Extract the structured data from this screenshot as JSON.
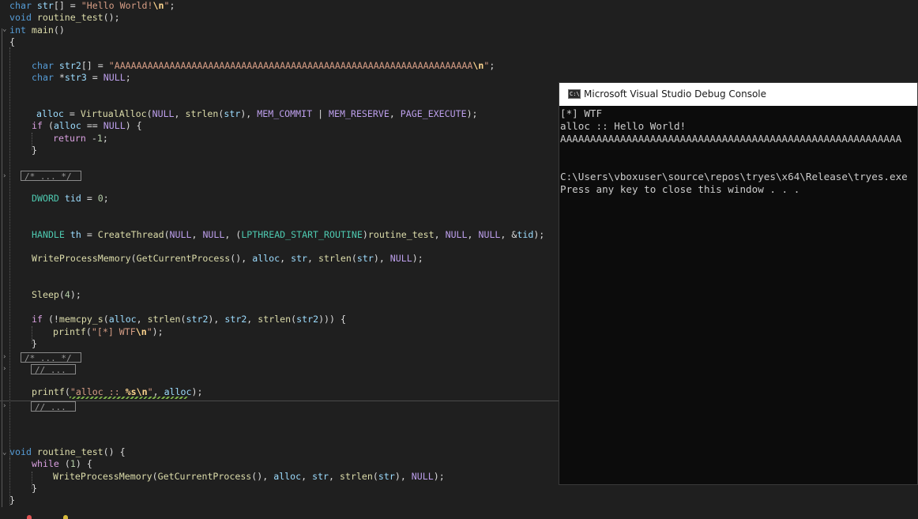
{
  "editor": {
    "lines": [
      [
        {
          "c": "t-kw",
          "t": "char "
        },
        {
          "c": "t-var",
          "t": "str"
        },
        {
          "c": "t-op",
          "t": "[] = "
        },
        {
          "c": "t-str",
          "t": "\"Hello World!"
        },
        {
          "c": "t-esc",
          "t": "\\n"
        },
        {
          "c": "t-str",
          "t": "\""
        },
        {
          "c": "t-op",
          "t": ";"
        }
      ],
      [
        {
          "c": "t-kw",
          "t": "void "
        },
        {
          "c": "t-fn",
          "t": "routine_test"
        },
        {
          "c": "t-op",
          "t": "();"
        }
      ],
      [
        {
          "c": "t-kw",
          "t": "int "
        },
        {
          "c": "t-fn",
          "t": "main"
        },
        {
          "c": "t-op",
          "t": "()"
        }
      ],
      [
        {
          "c": "t-op",
          "t": "{"
        }
      ],
      [
        {
          "c": "t-kw",
          "t": "char "
        },
        {
          "c": "t-var",
          "t": "str2"
        },
        {
          "c": "t-op",
          "t": "[] = "
        },
        {
          "c": "t-str",
          "t": "\"AAAAAAAAAAAAAAAAAAAAAAAAAAAAAAAAAAAAAAAAAAAAAAAAAAAAAAAAAAAAAAAAA"
        },
        {
          "c": "t-esc",
          "t": "\\n"
        },
        {
          "c": "t-str",
          "t": "\""
        },
        {
          "c": "t-op",
          "t": ";"
        }
      ],
      [
        {
          "c": "t-kw",
          "t": "char "
        },
        {
          "c": "t-op",
          "t": "*"
        },
        {
          "c": "t-var",
          "t": "str3"
        },
        {
          "c": "t-op",
          "t": " = "
        },
        {
          "c": "t-macro",
          "t": "NULL"
        },
        {
          "c": "t-op",
          "t": ";"
        }
      ],
      [
        {
          "c": "t-var",
          "t": "alloc"
        },
        {
          "c": "t-op",
          "t": " = "
        },
        {
          "c": "t-fn",
          "t": "VirtualAlloc"
        },
        {
          "c": "t-op",
          "t": "("
        },
        {
          "c": "t-macro",
          "t": "NULL"
        },
        {
          "c": "t-op",
          "t": ", "
        },
        {
          "c": "t-fn",
          "t": "strlen"
        },
        {
          "c": "t-op",
          "t": "("
        },
        {
          "c": "t-var",
          "t": "str"
        },
        {
          "c": "t-op",
          "t": "), "
        },
        {
          "c": "t-macro",
          "t": "MEM_COMMIT"
        },
        {
          "c": "t-op",
          "t": " | "
        },
        {
          "c": "t-macro",
          "t": "MEM_RESERVE"
        },
        {
          "c": "t-op",
          "t": ", "
        },
        {
          "c": "t-macro",
          "t": "PAGE_EXECUTE"
        },
        {
          "c": "t-op",
          "t": ");"
        }
      ],
      [
        {
          "c": "t-ctl",
          "t": "if "
        },
        {
          "c": "t-op",
          "t": "("
        },
        {
          "c": "t-var",
          "t": "alloc"
        },
        {
          "c": "t-op",
          "t": " == "
        },
        {
          "c": "t-macro",
          "t": "NULL"
        },
        {
          "c": "t-op",
          "t": ") {"
        }
      ],
      [
        {
          "c": "t-ctl",
          "t": "return "
        },
        {
          "c": "t-op",
          "t": "-"
        },
        {
          "c": "t-num",
          "t": "1"
        },
        {
          "c": "t-op",
          "t": ";"
        }
      ],
      [
        {
          "c": "t-op",
          "t": "}"
        }
      ],
      [
        {
          "c": "t-type",
          "t": "DWORD "
        },
        {
          "c": "t-var",
          "t": "tid"
        },
        {
          "c": "t-op",
          "t": " = "
        },
        {
          "c": "t-num",
          "t": "0"
        },
        {
          "c": "t-op",
          "t": ";"
        }
      ],
      [
        {
          "c": "t-type",
          "t": "HANDLE "
        },
        {
          "c": "t-var",
          "t": "th"
        },
        {
          "c": "t-op",
          "t": " = "
        },
        {
          "c": "t-fn",
          "t": "CreateThread"
        },
        {
          "c": "t-op",
          "t": "("
        },
        {
          "c": "t-macro",
          "t": "NULL"
        },
        {
          "c": "t-op",
          "t": ", "
        },
        {
          "c": "t-macro",
          "t": "NULL"
        },
        {
          "c": "t-op",
          "t": ", ("
        },
        {
          "c": "t-type",
          "t": "LPTHREAD_START_ROUTINE"
        },
        {
          "c": "t-op",
          "t": ")"
        },
        {
          "c": "t-fn",
          "t": "routine_test"
        },
        {
          "c": "t-op",
          "t": ", "
        },
        {
          "c": "t-macro",
          "t": "NULL"
        },
        {
          "c": "t-op",
          "t": ", "
        },
        {
          "c": "t-macro",
          "t": "NULL"
        },
        {
          "c": "t-op",
          "t": ", &"
        },
        {
          "c": "t-var",
          "t": "tid"
        },
        {
          "c": "t-op",
          "t": ");"
        }
      ],
      [
        {
          "c": "t-fn",
          "t": "WriteProcessMemory"
        },
        {
          "c": "t-op",
          "t": "("
        },
        {
          "c": "t-fn",
          "t": "GetCurrentProcess"
        },
        {
          "c": "t-op",
          "t": "(), "
        },
        {
          "c": "t-var",
          "t": "alloc"
        },
        {
          "c": "t-op",
          "t": ", "
        },
        {
          "c": "t-var",
          "t": "str"
        },
        {
          "c": "t-op",
          "t": ", "
        },
        {
          "c": "t-fn",
          "t": "strlen"
        },
        {
          "c": "t-op",
          "t": "("
        },
        {
          "c": "t-var",
          "t": "str"
        },
        {
          "c": "t-op",
          "t": "), "
        },
        {
          "c": "t-macro",
          "t": "NULL"
        },
        {
          "c": "t-op",
          "t": ");"
        }
      ],
      [
        {
          "c": "t-fn",
          "t": "Sleep"
        },
        {
          "c": "t-op",
          "t": "("
        },
        {
          "c": "t-num",
          "t": "4"
        },
        {
          "c": "t-op",
          "t": ");"
        }
      ],
      [
        {
          "c": "t-ctl",
          "t": "if "
        },
        {
          "c": "t-op",
          "t": "(!"
        },
        {
          "c": "t-fn",
          "t": "memcpy_s"
        },
        {
          "c": "t-op",
          "t": "("
        },
        {
          "c": "t-var",
          "t": "alloc"
        },
        {
          "c": "t-op",
          "t": ", "
        },
        {
          "c": "t-fn",
          "t": "strlen"
        },
        {
          "c": "t-op",
          "t": "("
        },
        {
          "c": "t-var",
          "t": "str2"
        },
        {
          "c": "t-op",
          "t": "), "
        },
        {
          "c": "t-var",
          "t": "str2"
        },
        {
          "c": "t-op",
          "t": ", "
        },
        {
          "c": "t-fn",
          "t": "strlen"
        },
        {
          "c": "t-op",
          "t": "("
        },
        {
          "c": "t-var",
          "t": "str2"
        },
        {
          "c": "t-op",
          "t": "))) {"
        }
      ],
      [
        {
          "c": "t-fn",
          "t": "printf"
        },
        {
          "c": "t-op",
          "t": "("
        },
        {
          "c": "t-str",
          "t": "\"[*] WTF"
        },
        {
          "c": "t-esc",
          "t": "\\n"
        },
        {
          "c": "t-str",
          "t": "\""
        },
        {
          "c": "t-op",
          "t": ");"
        }
      ],
      [
        {
          "c": "t-op",
          "t": "}"
        }
      ],
      [
        {
          "c": "t-fn",
          "t": "printf"
        },
        {
          "c": "t-op",
          "t": "("
        },
        {
          "c": "t-str",
          "t": "\"alloc :: "
        },
        {
          "c": "t-esc",
          "t": "%s\\n"
        },
        {
          "c": "t-str",
          "t": "\""
        },
        {
          "c": "t-op",
          "t": ", "
        },
        {
          "c": "t-var",
          "t": "alloc"
        },
        {
          "c": "t-op",
          "t": ");"
        }
      ],
      [
        {
          "c": "t-kw",
          "t": "void "
        },
        {
          "c": "t-fn",
          "t": "routine_test"
        },
        {
          "c": "t-op",
          "t": "() {"
        }
      ],
      [
        {
          "c": "t-ctl",
          "t": "while "
        },
        {
          "c": "t-op",
          "t": "("
        },
        {
          "c": "t-num",
          "t": "1"
        },
        {
          "c": "t-op",
          "t": ") {"
        }
      ],
      [
        {
          "c": "t-fn",
          "t": "WriteProcessMemory"
        },
        {
          "c": "t-op",
          "t": "("
        },
        {
          "c": "t-fn",
          "t": "GetCurrentProcess"
        },
        {
          "c": "t-op",
          "t": "(), "
        },
        {
          "c": "t-var",
          "t": "alloc"
        },
        {
          "c": "t-op",
          "t": ", "
        },
        {
          "c": "t-var",
          "t": "str"
        },
        {
          "c": "t-op",
          "t": ", "
        },
        {
          "c": "t-fn",
          "t": "strlen"
        },
        {
          "c": "t-op",
          "t": "("
        },
        {
          "c": "t-var",
          "t": "str"
        },
        {
          "c": "t-op",
          "t": "), "
        },
        {
          "c": "t-macro",
          "t": "NULL"
        },
        {
          "c": "t-op",
          "t": ");"
        }
      ],
      [
        {
          "c": "t-op",
          "t": "}"
        }
      ],
      [
        {
          "c": "t-op",
          "t": "}"
        }
      ]
    ],
    "folds": [
      "/* ... */",
      "/* ... */",
      "// ...",
      "// ..."
    ]
  },
  "console": {
    "title": "Microsoft Visual Studio Debug Console",
    "icon_label": "C:\\",
    "lines": [
      "[*] WTF",
      "alloc :: Hello World!",
      "AAAAAAAAAAAAAAAAAAAAAAAAAAAAAAAAAAAAAAAAAAAAAAAAAAAAAAAAA",
      "",
      "",
      "C:\\Users\\vboxuser\\source\\repos\\tryes\\x64\\Release\\tryes.exe",
      "Press any key to close this window . . ."
    ]
  },
  "colors": {
    "editor_bg": "#1f1f1f",
    "console_bg": "#0c0c0c",
    "keyword": "#569cd6",
    "string": "#d69d85",
    "function": "#dcdcaa",
    "variable": "#9cdcfe",
    "macro": "#bd9fec",
    "type": "#4ec9b0"
  }
}
